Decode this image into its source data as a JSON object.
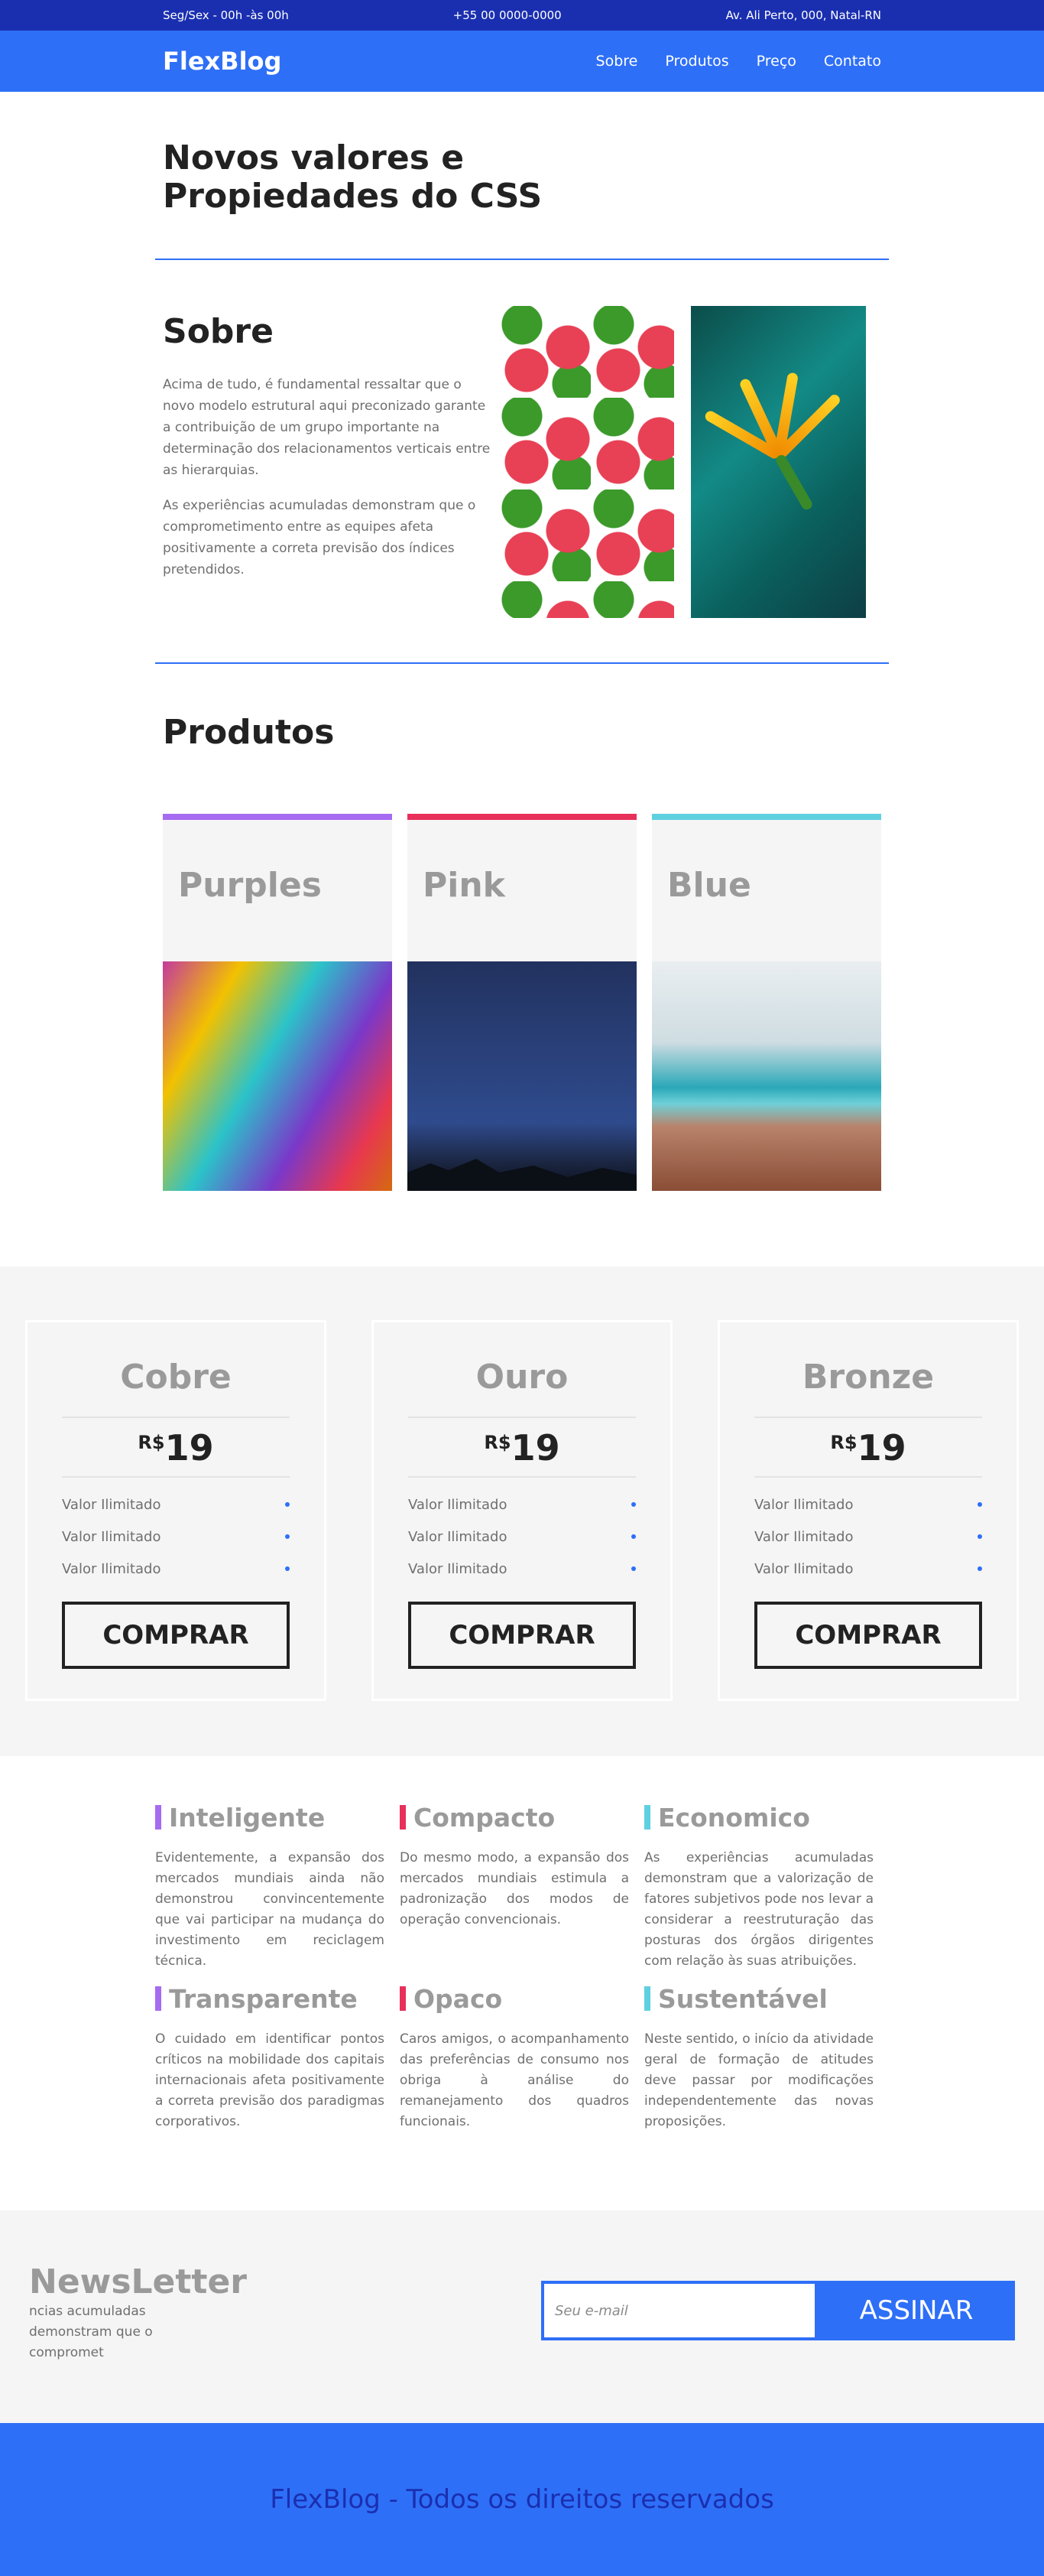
{
  "topbar": {
    "hours": "Seg/Sex - 00h -às 00h",
    "phone": "+55 00 0000-0000",
    "address": "Av. Ali Perto, 000, Natal-RN"
  },
  "header": {
    "logo": "FlexBlog",
    "nav": [
      "Sobre",
      "Produtos",
      "Preço",
      "Contato"
    ]
  },
  "hero": {
    "title": "Novos valores e Propiedades do CSS"
  },
  "sobre": {
    "title": "Sobre",
    "paragraphs": [
      "Acima de tudo, é fundamental ressaltar que o novo modelo estrutural aqui preconizado garante a contribuição de um grupo importante na determinação dos relacionamentos verticais entre as hierarquias.",
      "As experiências acumuladas demonstram que o comprometimento entre as equipes afeta positivamente a correta previsão dos índices pretendidos."
    ]
  },
  "produtos": {
    "title": "Produtos",
    "cards": [
      {
        "label": "Purples",
        "color": "#a66bf1"
      },
      {
        "label": "Pink",
        "color": "#e8305a"
      },
      {
        "label": "Blue",
        "color": "#5fd0e0"
      }
    ]
  },
  "pricing": {
    "plans": [
      {
        "name": "Cobre",
        "currency": "R$",
        "value": "19",
        "features": [
          "Valor Ilimitado",
          "Valor Ilimitado",
          "Valor Ilimitado"
        ],
        "button": "COMPRAR"
      },
      {
        "name": "Ouro",
        "currency": "R$",
        "value": "19",
        "features": [
          "Valor Ilimitado",
          "Valor Ilimitado",
          "Valor Ilimitado"
        ],
        "button": "COMPRAR"
      },
      {
        "name": "Bronze",
        "currency": "R$",
        "value": "19",
        "features": [
          "Valor Ilimitado",
          "Valor Ilimitado",
          "Valor Ilimitado"
        ],
        "button": "COMPRAR"
      }
    ]
  },
  "features": [
    {
      "title": "Inteligente",
      "color": "#a66bf1",
      "text": "Evidentemente, a expansão dos mercados mundiais ainda não demonstrou convincentemente que vai participar na mudança do investimento em reciclagem técnica."
    },
    {
      "title": "Compacto",
      "color": "#e8305a",
      "text": "Do mesmo modo, a expansão dos mercados mundiais estimula a padronização dos modos de operação convencionais."
    },
    {
      "title": "Economico",
      "color": "#5fd0e0",
      "text": "As experiências acumuladas demonstram que a valorização de fatores subjetivos pode nos levar a considerar a reestruturação das posturas dos órgãos dirigentes com relação às suas atribuições."
    },
    {
      "title": "Transparente",
      "color": "#a66bf1",
      "text": "O cuidado em identificar pontos críticos na mobilidade dos capitais internacionais afeta positivamente a correta previsão dos paradigmas corporativos."
    },
    {
      "title": "Opaco",
      "color": "#e8305a",
      "text": "Caros amigos, o acompanhamento das preferências de consumo nos obriga à análise do remanejamento dos quadros funcionais."
    },
    {
      "title": "Sustentável",
      "color": "#5fd0e0",
      "text": "Neste sentido, o início da atividade geral de formação de atitudes deve passar por modificações independentemente das novas proposições."
    }
  ],
  "newsletter": {
    "title": "NewsLetter",
    "text": "ncias acumuladas demonstram que o compromet",
    "placeholder": "Seu e-mail",
    "button": "ASSINAR"
  },
  "footer": {
    "text": "FlexBlog - Todos os direitos reservados"
  }
}
